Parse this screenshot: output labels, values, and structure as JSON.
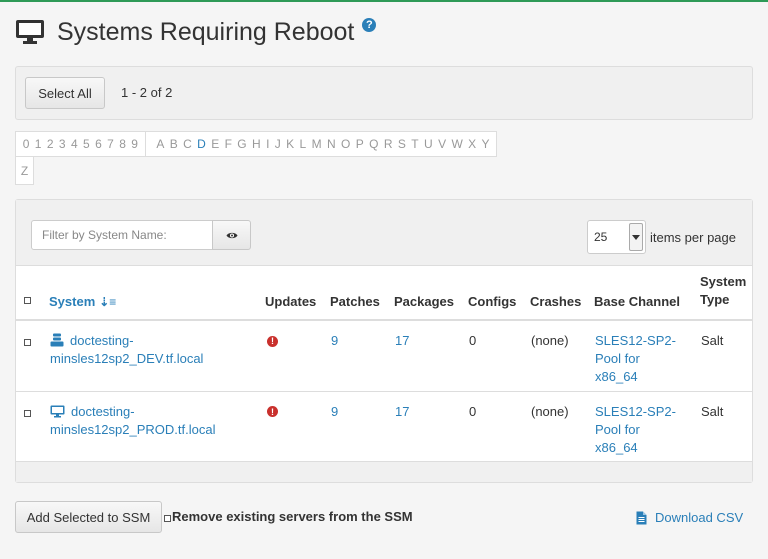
{
  "header": {
    "title": "Systems Requiring Reboot",
    "help_symbol": "?",
    "icon": "monitor-icon"
  },
  "selection": {
    "select_all_label": "Select All",
    "page_range": "1 - 2 of 2"
  },
  "alphabet": {
    "digits": [
      "0",
      "1",
      "2",
      "3",
      "4",
      "5",
      "6",
      "7",
      "8",
      "9"
    ],
    "letters": [
      "A",
      "B",
      "C",
      "D",
      "E",
      "F",
      "G",
      "H",
      "I",
      "J",
      "K",
      "L",
      "M",
      "N",
      "O",
      "P",
      "Q",
      "R",
      "S",
      "T",
      "U",
      "V",
      "W",
      "X",
      "Y"
    ],
    "overflow": "Z",
    "active": "D"
  },
  "filter": {
    "placeholder": "Filter by System Name:",
    "value": ""
  },
  "pagination": {
    "per_page_value": "25",
    "per_page_label": "items per page"
  },
  "table": {
    "columns": {
      "system": "System",
      "updates": "Updates",
      "patches": "Patches",
      "packages": "Packages",
      "configs": "Configs",
      "crashes": "Crashes",
      "base_channel": "Base Channel",
      "system_type_1": "System",
      "system_type_2": "Type"
    },
    "rows": [
      {
        "system_line1": "doctesting-",
        "system_line2": "minsles12sp2_DEV.tf.local",
        "system_icon": "virtual-host-icon",
        "updates_icon": "critical-updates-icon",
        "patches": "9",
        "packages": "17",
        "configs": "0",
        "crashes": "(none)",
        "channel_line1": "SLES12-SP2-",
        "channel_line2": "Pool for",
        "channel_line3": "x86_64",
        "system_type": "Salt"
      },
      {
        "system_line1": "doctesting-",
        "system_line2": "minsles12sp2_PROD.tf.local",
        "system_icon": "monitor-icon",
        "updates_icon": "critical-updates-icon",
        "patches": "9",
        "packages": "17",
        "configs": "0",
        "crashes": "(none)",
        "channel_line1": "SLES12-SP2-",
        "channel_line2": "Pool for",
        "channel_line3": "x86_64",
        "system_type": "Salt"
      }
    ]
  },
  "footer": {
    "add_to_ssm_label": "Add Selected to SSM",
    "remove_option_label": "Remove existing servers from the SSM",
    "download_csv_label": "Download CSV"
  },
  "colors": {
    "accent_green": "#2e9a57",
    "link_blue": "#2a7fb8",
    "error_red": "#c9302c"
  }
}
